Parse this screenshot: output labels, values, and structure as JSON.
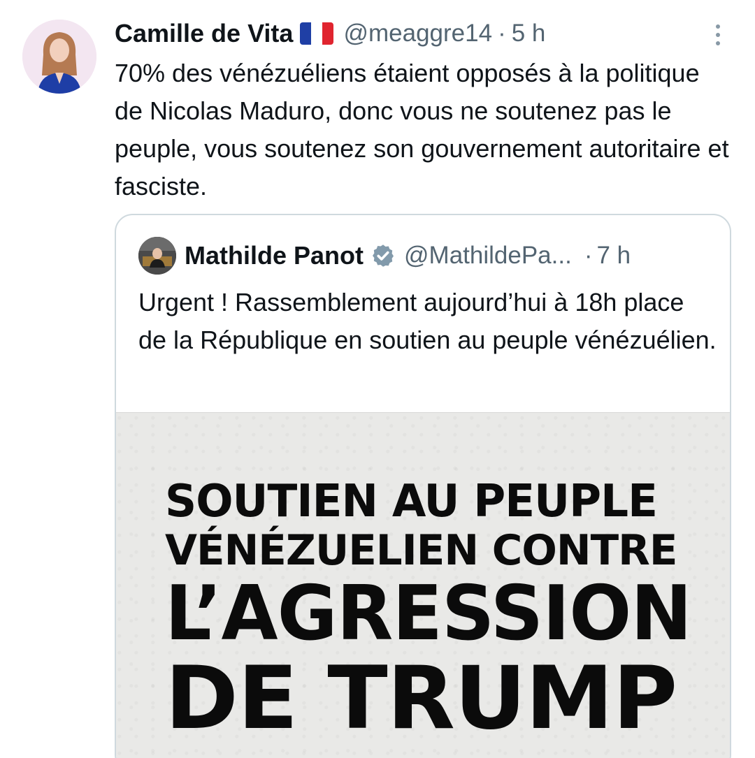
{
  "tweet": {
    "author_name": "Camille de Vita",
    "flag_icon": "france-flag-icon",
    "handle": "@meaggre14",
    "separator": "·",
    "time": "5 h",
    "more_icon": "more-options-icon",
    "text": "70% des vénézuéliens étaient opposés à la politique de Nicolas Maduro, donc vous ne soutenez pas le peuple, vous soutenez son gouvernement autoritaire et fasciste."
  },
  "quoted": {
    "author_name": "Mathilde Panot",
    "verified_icon": "verified-badge-icon",
    "handle": "@MathildePa...",
    "separator": "·",
    "time": "7 h",
    "text": "Urgent ! Rassemblement aujourd’hui à 18h place de la République en soutien au peuple vénézuélien.",
    "poster": {
      "line1": "SOUTIEN AU PEUPLE",
      "line2": "VÉNÉZUELIEN CONTRE",
      "line3": "L’AGRESSION",
      "line4": "DE TRUMP"
    }
  },
  "colors": {
    "text_primary": "#0f1419",
    "text_secondary": "#536471",
    "border": "#cfd9de",
    "verified_badge": "#829aab"
  }
}
